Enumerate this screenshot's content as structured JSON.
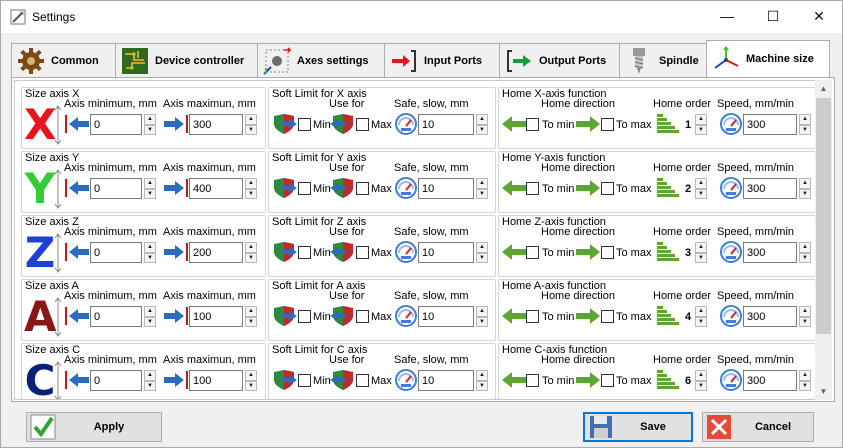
{
  "window": {
    "title": "Settings",
    "controls": [
      "minimize",
      "maximize",
      "close"
    ]
  },
  "tabs": [
    {
      "label": "Common",
      "icon": "gear-icon",
      "active": false
    },
    {
      "label": "Device controller",
      "icon": "circuit-board-icon",
      "active": false
    },
    {
      "label": "Axes settings",
      "icon": "axes-settings-icon",
      "active": false
    },
    {
      "label": "Input Ports",
      "icon": "input-arrow-icon",
      "active": false
    },
    {
      "label": "Output Ports",
      "icon": "output-arrow-icon",
      "active": false
    },
    {
      "label": "Spindle",
      "icon": "spindle-icon",
      "active": false
    },
    {
      "label": "Machine size",
      "icon": "xyz-axes-icon",
      "active": true
    }
  ],
  "labels": {
    "axis_min": "Axis minimum, mm",
    "axis_max": "Axis maximun, mm",
    "use_for": "Use for",
    "safe_slow": "Safe, slow, mm",
    "home_direction": "Home direction",
    "home_order": "Home order",
    "speed": "Speed, mm/min",
    "min": "Min",
    "max": "Max",
    "to_min": "To min",
    "to_max": "To max"
  },
  "axes": [
    {
      "letter": "X",
      "color": "#e8141e",
      "size_title": "Size axis X",
      "soft_title": "Soft Limit for X axis",
      "home_title": "Home X-axis function",
      "min": "0",
      "max": "300",
      "safe": "10",
      "order": "1",
      "speed": "300"
    },
    {
      "letter": "Y",
      "color": "#33cc33",
      "size_title": "Size axis Y",
      "soft_title": "Soft Limit for Y axis",
      "home_title": "Home Y-axis function",
      "min": "0",
      "max": "400",
      "safe": "10",
      "order": "2",
      "speed": "300"
    },
    {
      "letter": "Z",
      "color": "#1f3fd6",
      "size_title": "Size axis Z",
      "soft_title": "Soft Limit for Z axis",
      "home_title": "Home Z-axis function",
      "min": "0",
      "max": "200",
      "safe": "10",
      "order": "3",
      "speed": "300"
    },
    {
      "letter": "A",
      "color": "#8b1414",
      "size_title": "Size axis A",
      "soft_title": "Soft Limit for A axis",
      "home_title": "Home A-axis function",
      "min": "0",
      "max": "100",
      "safe": "10",
      "order": "4",
      "speed": "300"
    },
    {
      "letter": "C",
      "color": "#0a1f7a",
      "size_title": "Size axis C",
      "soft_title": "Soft Limit for C axis",
      "home_title": "Home C-axis function",
      "min": "0",
      "max": "100",
      "safe": "10",
      "order": "6",
      "speed": "300"
    }
  ],
  "buttons": {
    "apply": "Apply",
    "save": "Save",
    "cancel": "Cancel"
  }
}
